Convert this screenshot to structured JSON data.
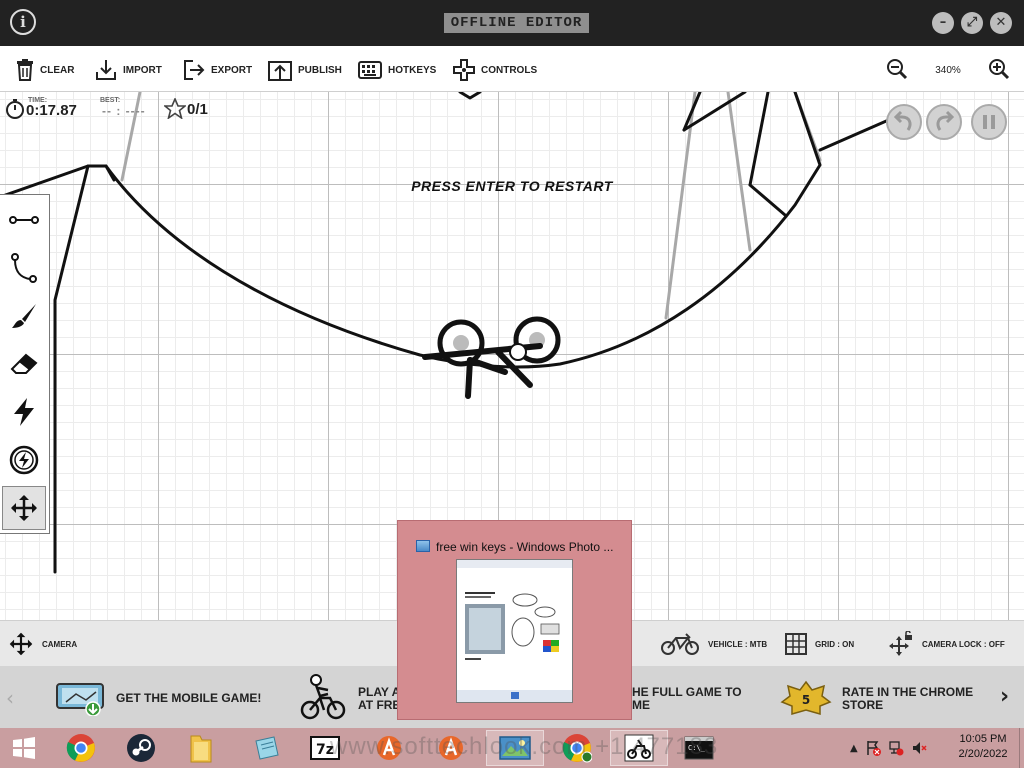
{
  "titlebar": {
    "title": "OFFLINE EDITOR"
  },
  "toolbar": {
    "clear": "CLEAR",
    "import": "IMPORT",
    "export": "EXPORT",
    "publish": "PUBLISH",
    "hotkeys": "HOTKEYS",
    "controls": "CONTROLS",
    "zoom": "340%"
  },
  "hud": {
    "time_label": "TIME:",
    "time": "0:17.87",
    "best_label": "BEST:",
    "best": "-- : ----",
    "stars": "0/1",
    "restart_message": "PRESS ENTER TO RESTART"
  },
  "bottom": {
    "camera": "CAMERA",
    "vehicle": "VEHICLE : MTB",
    "grid": "GRID : ON",
    "camera_lock": "CAMERA LOCK : OFF"
  },
  "promo": {
    "mobile": "GET THE MOBILE GAME!",
    "play_line1": "PLAY AL",
    "play_line2": "AT FREE",
    "full_line1": "HE FULL GAME TO",
    "full_line2": "ME",
    "rate_line1": "RATE IN THE CHROME",
    "rate_line2": "STORE",
    "badge": "5"
  },
  "popup": {
    "title": "free win keys - Windows Photo ..."
  },
  "taskbar": {
    "watermark": "www.softtechlook.com +1 477183",
    "time": "10:05 PM",
    "date": "2/20/2022"
  }
}
